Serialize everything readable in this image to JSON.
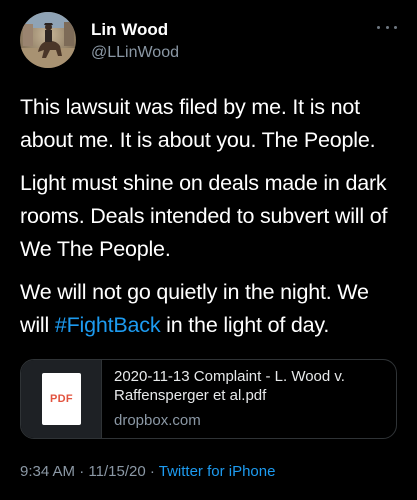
{
  "author": {
    "display_name": "Lin Wood",
    "handle": "@LLinWood",
    "avatar_icon": "avatar-horse-rider"
  },
  "menu": {
    "icon": "more-horizontal-icon"
  },
  "tweet": {
    "paragraphs": [
      "This lawsuit was filed by me. It is not about me. It is about you. The People.",
      "Light must shine on deals made in dark rooms. Deals intended to subvert will of We The People."
    ],
    "last_paragraph": {
      "before": "We will not go quietly in the night. We will ",
      "hashtag": "#FightBack",
      "after": " in the light of day."
    }
  },
  "attachment": {
    "icon_label": "PDF",
    "title": "2020-11-13 Complaint - L. Wood v. Raffensperger et al.pdf",
    "domain": "dropbox.com"
  },
  "meta": {
    "time": "9:34 AM",
    "separator1": " · ",
    "date": "11/15/20",
    "separator2": " · ",
    "source": "Twitter for iPhone"
  },
  "colors": {
    "background": "#000000",
    "text": "#ffffff",
    "secondary": "#8b98a5",
    "link": "#1d9bf0",
    "border": "#2f3336",
    "pdf_red": "#e2533f"
  }
}
